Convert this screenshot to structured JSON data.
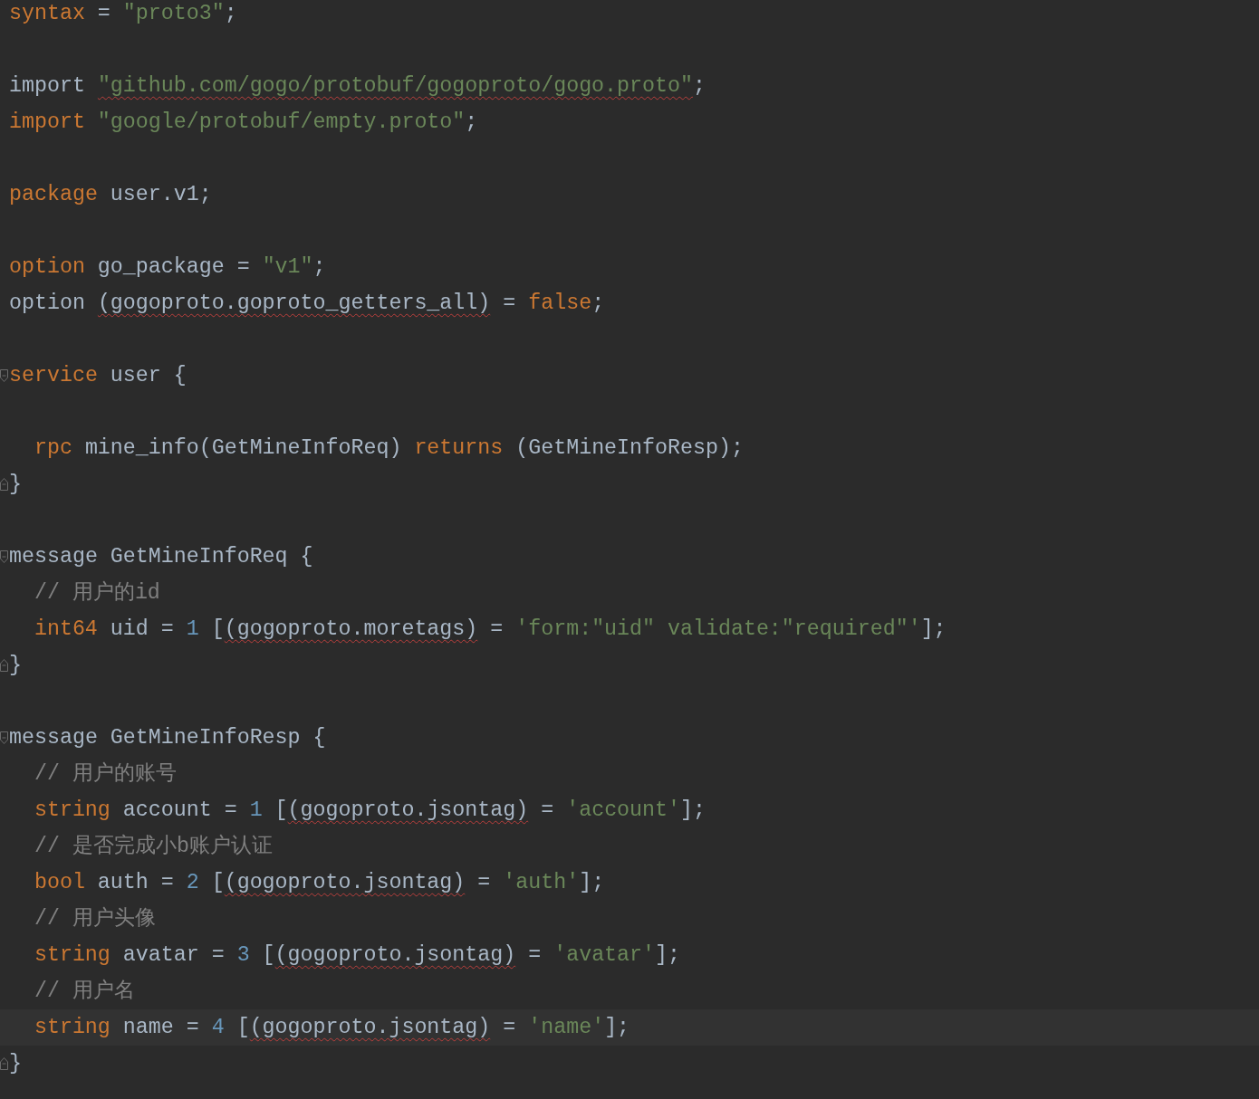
{
  "editor": {
    "lines": [
      {
        "kind": "code",
        "tokens": [
          {
            "kind": "keyword",
            "text": "syntax"
          },
          {
            "kind": "plain",
            "text": " = "
          },
          {
            "kind": "string",
            "text": "\"proto3\""
          },
          {
            "kind": "plain",
            "text": ";"
          }
        ]
      },
      {
        "kind": "blank"
      },
      {
        "kind": "code",
        "tokens": [
          {
            "kind": "plain",
            "text": "import "
          },
          {
            "kind": "string",
            "text": "\"github.com/gogo/protobuf/gogoproto/gogo.proto\"",
            "error": true
          },
          {
            "kind": "plain",
            "text": ";"
          }
        ]
      },
      {
        "kind": "code",
        "tokens": [
          {
            "kind": "keyword",
            "text": "import"
          },
          {
            "kind": "string",
            "text": " \"google/protobuf/empty.proto\""
          },
          {
            "kind": "plain",
            "text": ";"
          }
        ]
      },
      {
        "kind": "blank"
      },
      {
        "kind": "code",
        "tokens": [
          {
            "kind": "keyword",
            "text": "package"
          },
          {
            "kind": "plain",
            "text": " user.v1;"
          }
        ]
      },
      {
        "kind": "blank"
      },
      {
        "kind": "code",
        "tokens": [
          {
            "kind": "keyword",
            "text": "option"
          },
          {
            "kind": "plain",
            "text": " go_package = "
          },
          {
            "kind": "string",
            "text": "\"v1\""
          },
          {
            "kind": "plain",
            "text": ";"
          }
        ]
      },
      {
        "kind": "code",
        "tokens": [
          {
            "kind": "plain",
            "text": "option "
          },
          {
            "kind": "plain",
            "text": "(gogoproto.goproto_getters_all)",
            "error": true
          },
          {
            "kind": "plain",
            "text": " = "
          },
          {
            "kind": "keyword",
            "text": "false"
          },
          {
            "kind": "plain",
            "text": ";"
          }
        ]
      },
      {
        "kind": "blank"
      },
      {
        "kind": "code",
        "fold_start": true,
        "tokens": [
          {
            "kind": "keyword",
            "text": "service"
          },
          {
            "kind": "plain",
            "text": " user {"
          }
        ]
      },
      {
        "kind": "blank"
      },
      {
        "kind": "code",
        "indented": true,
        "tokens": [
          {
            "kind": "keyword",
            "text": "rpc"
          },
          {
            "kind": "plain",
            "text": " mine_info(GetMineInfoReq) "
          },
          {
            "kind": "keyword",
            "text": "returns"
          },
          {
            "kind": "plain",
            "text": " (GetMineInfoResp);"
          }
        ]
      },
      {
        "kind": "code",
        "fold_end": true,
        "tokens": [
          {
            "kind": "plain",
            "text": "}"
          }
        ]
      },
      {
        "kind": "blank"
      },
      {
        "kind": "code",
        "fold_start": true,
        "tokens": [
          {
            "kind": "plain",
            "text": "message GetMineInfoReq {"
          }
        ]
      },
      {
        "kind": "code",
        "indented": true,
        "tokens": [
          {
            "kind": "comment",
            "text": "// 用户的id"
          }
        ]
      },
      {
        "kind": "code",
        "indented": true,
        "tokens": [
          {
            "kind": "keyword",
            "text": "int64"
          },
          {
            "kind": "plain",
            "text": " uid = "
          },
          {
            "kind": "number",
            "text": "1"
          },
          {
            "kind": "plain",
            "text": " ["
          },
          {
            "kind": "plain",
            "text": "(gogoproto.moretags)",
            "error": true
          },
          {
            "kind": "plain",
            "text": " = "
          },
          {
            "kind": "string",
            "text": "'form:\"uid\" validate:\"required\"'"
          },
          {
            "kind": "plain",
            "text": "];"
          }
        ]
      },
      {
        "kind": "code",
        "fold_end": true,
        "tokens": [
          {
            "kind": "plain",
            "text": "}"
          }
        ]
      },
      {
        "kind": "blank"
      },
      {
        "kind": "code",
        "fold_start": true,
        "tokens": [
          {
            "kind": "plain",
            "text": "message GetMineInfoResp {"
          }
        ]
      },
      {
        "kind": "code",
        "indented": true,
        "tokens": [
          {
            "kind": "comment",
            "text": "// 用户的账号"
          }
        ]
      },
      {
        "kind": "code",
        "indented": true,
        "tokens": [
          {
            "kind": "keyword",
            "text": "string"
          },
          {
            "kind": "plain",
            "text": " account = "
          },
          {
            "kind": "number",
            "text": "1"
          },
          {
            "kind": "plain",
            "text": " ["
          },
          {
            "kind": "plain",
            "text": "(gogoproto.jsontag)",
            "error": true
          },
          {
            "kind": "plain",
            "text": " = "
          },
          {
            "kind": "string",
            "text": "'account'"
          },
          {
            "kind": "plain",
            "text": "];"
          }
        ]
      },
      {
        "kind": "code",
        "indented": true,
        "tokens": [
          {
            "kind": "comment",
            "text": "// 是否完成小b账户认证"
          }
        ]
      },
      {
        "kind": "code",
        "indented": true,
        "tokens": [
          {
            "kind": "keyword",
            "text": "bool"
          },
          {
            "kind": "plain",
            "text": " auth = "
          },
          {
            "kind": "number",
            "text": "2"
          },
          {
            "kind": "plain",
            "text": " ["
          },
          {
            "kind": "plain",
            "text": "(gogoproto.jsontag)",
            "error": true
          },
          {
            "kind": "plain",
            "text": " = "
          },
          {
            "kind": "string",
            "text": "'auth'"
          },
          {
            "kind": "plain",
            "text": "];"
          }
        ]
      },
      {
        "kind": "code",
        "indented": true,
        "tokens": [
          {
            "kind": "comment",
            "text": "// 用户头像"
          }
        ]
      },
      {
        "kind": "code",
        "indented": true,
        "tokens": [
          {
            "kind": "keyword",
            "text": "string"
          },
          {
            "kind": "plain",
            "text": " avatar = "
          },
          {
            "kind": "number",
            "text": "3"
          },
          {
            "kind": "plain",
            "text": " ["
          },
          {
            "kind": "plain",
            "text": "(gogoproto.jsontag)",
            "error": true
          },
          {
            "kind": "plain",
            "text": " = "
          },
          {
            "kind": "string",
            "text": "'avatar'"
          },
          {
            "kind": "plain",
            "text": "];"
          }
        ]
      },
      {
        "kind": "code",
        "indented": true,
        "tokens": [
          {
            "kind": "comment",
            "text": "// 用户名"
          }
        ]
      },
      {
        "kind": "code",
        "indented": true,
        "current": true,
        "tokens": [
          {
            "kind": "keyword",
            "text": "string"
          },
          {
            "kind": "plain",
            "text": " name = "
          },
          {
            "kind": "number",
            "text": "4"
          },
          {
            "kind": "plain",
            "text": " ["
          },
          {
            "kind": "plain",
            "text": "(gogoproto.jsontag)",
            "error": true
          },
          {
            "kind": "plain",
            "text": " = "
          },
          {
            "kind": "string",
            "text": "'name'"
          },
          {
            "kind": "plain",
            "text": "];"
          }
        ]
      },
      {
        "kind": "code",
        "fold_end": true,
        "tokens": [
          {
            "kind": "plain",
            "text": "}"
          }
        ]
      }
    ]
  }
}
